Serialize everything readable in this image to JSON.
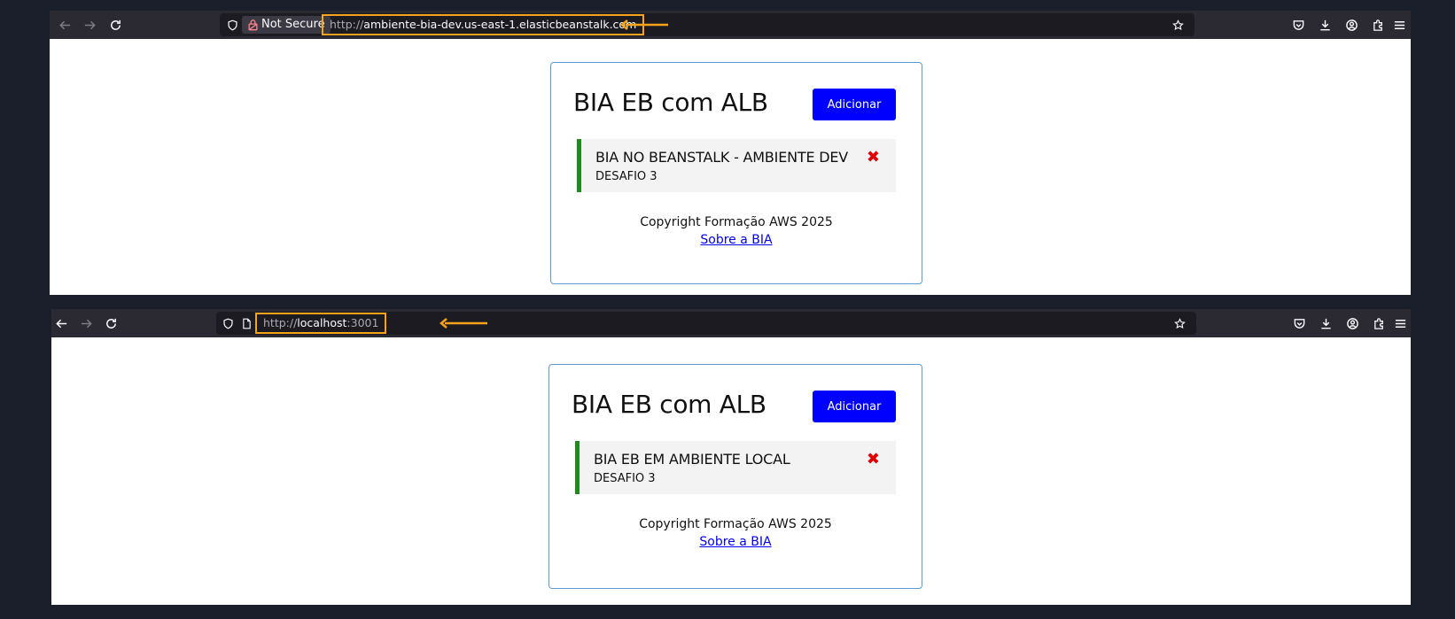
{
  "windows": [
    {
      "urlbar": {
        "security_label": "Not Secure",
        "url_scheme": "http://",
        "url_host": "ambiente-bia-dev.us-east-1.elasticbeanstalk.com",
        "url_port": ""
      },
      "app": {
        "title": "BIA EB com ALB",
        "add_label": "Adicionar",
        "task": {
          "title": "BIA NO BEANSTALK - AMBIENTE DEV",
          "subtitle": "DESAFIO 3",
          "delete_glyph": "✖"
        },
        "footer": {
          "copyright": "Copyright Formação AWS 2025",
          "link": "Sobre a BIA"
        }
      }
    },
    {
      "urlbar": {
        "url_scheme": "http://",
        "url_host": "localhost",
        "url_port": ":3001"
      },
      "app": {
        "title": "BIA EB com ALB",
        "add_label": "Adicionar",
        "task": {
          "title": "BIA EB EM AMBIENTE LOCAL",
          "subtitle": "DESAFIO 3",
          "delete_glyph": "✖"
        },
        "footer": {
          "copyright": "Copyright Formação AWS 2025",
          "link": "Sobre a BIA"
        }
      }
    }
  ],
  "icons": [
    "back-icon",
    "forward-icon",
    "reload-icon",
    "shield-icon",
    "lock-icon",
    "page-icon",
    "bookmark-star-icon",
    "pocket-icon",
    "download-icon",
    "account-icon",
    "extensions-icon",
    "menu-icon",
    "arrow-icon"
  ],
  "colors": {
    "highlight": "#f7a21b",
    "button": "#0000ff",
    "task_border": "#1e8a1e",
    "delete": "#e00000",
    "toolbar": "#2b2a33",
    "urlbar": "#1c1b22"
  }
}
